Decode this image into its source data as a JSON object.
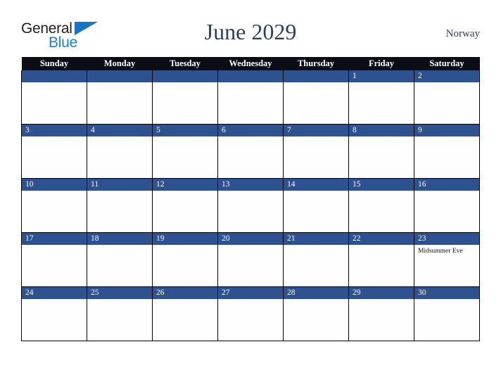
{
  "brand": {
    "word_one": "General",
    "word_two": "Blue",
    "triangle_icon": "triangle-icon",
    "colors": {
      "general_text": "#231f20",
      "blue_text": "#1a80d4",
      "triangle": "#1773c4"
    }
  },
  "header": {
    "title": "June 2029",
    "country": "Norway",
    "title_color": "#2b4069"
  },
  "calendar": {
    "weekday_headers": [
      "Sunday",
      "Monday",
      "Tuesday",
      "Wednesday",
      "Thursday",
      "Friday",
      "Saturday"
    ],
    "header_bg": "#0c0c16",
    "daynum_bg": "#2e5190",
    "grid_border": "#000000",
    "weeks": [
      [
        {
          "day": "",
          "events": []
        },
        {
          "day": "",
          "events": []
        },
        {
          "day": "",
          "events": []
        },
        {
          "day": "",
          "events": []
        },
        {
          "day": "",
          "events": []
        },
        {
          "day": "1",
          "events": []
        },
        {
          "day": "2",
          "events": []
        }
      ],
      [
        {
          "day": "3",
          "events": []
        },
        {
          "day": "4",
          "events": []
        },
        {
          "day": "5",
          "events": []
        },
        {
          "day": "6",
          "events": []
        },
        {
          "day": "7",
          "events": []
        },
        {
          "day": "8",
          "events": []
        },
        {
          "day": "9",
          "events": []
        }
      ],
      [
        {
          "day": "10",
          "events": []
        },
        {
          "day": "11",
          "events": []
        },
        {
          "day": "12",
          "events": []
        },
        {
          "day": "13",
          "events": []
        },
        {
          "day": "14",
          "events": []
        },
        {
          "day": "15",
          "events": []
        },
        {
          "day": "16",
          "events": []
        }
      ],
      [
        {
          "day": "17",
          "events": []
        },
        {
          "day": "18",
          "events": []
        },
        {
          "day": "19",
          "events": []
        },
        {
          "day": "20",
          "events": []
        },
        {
          "day": "21",
          "events": []
        },
        {
          "day": "22",
          "events": []
        },
        {
          "day": "23",
          "events": [
            "Midsummer Eve"
          ]
        }
      ],
      [
        {
          "day": "24",
          "events": []
        },
        {
          "day": "25",
          "events": []
        },
        {
          "day": "26",
          "events": []
        },
        {
          "day": "27",
          "events": []
        },
        {
          "day": "28",
          "events": []
        },
        {
          "day": "29",
          "events": []
        },
        {
          "day": "30",
          "events": []
        }
      ]
    ]
  }
}
